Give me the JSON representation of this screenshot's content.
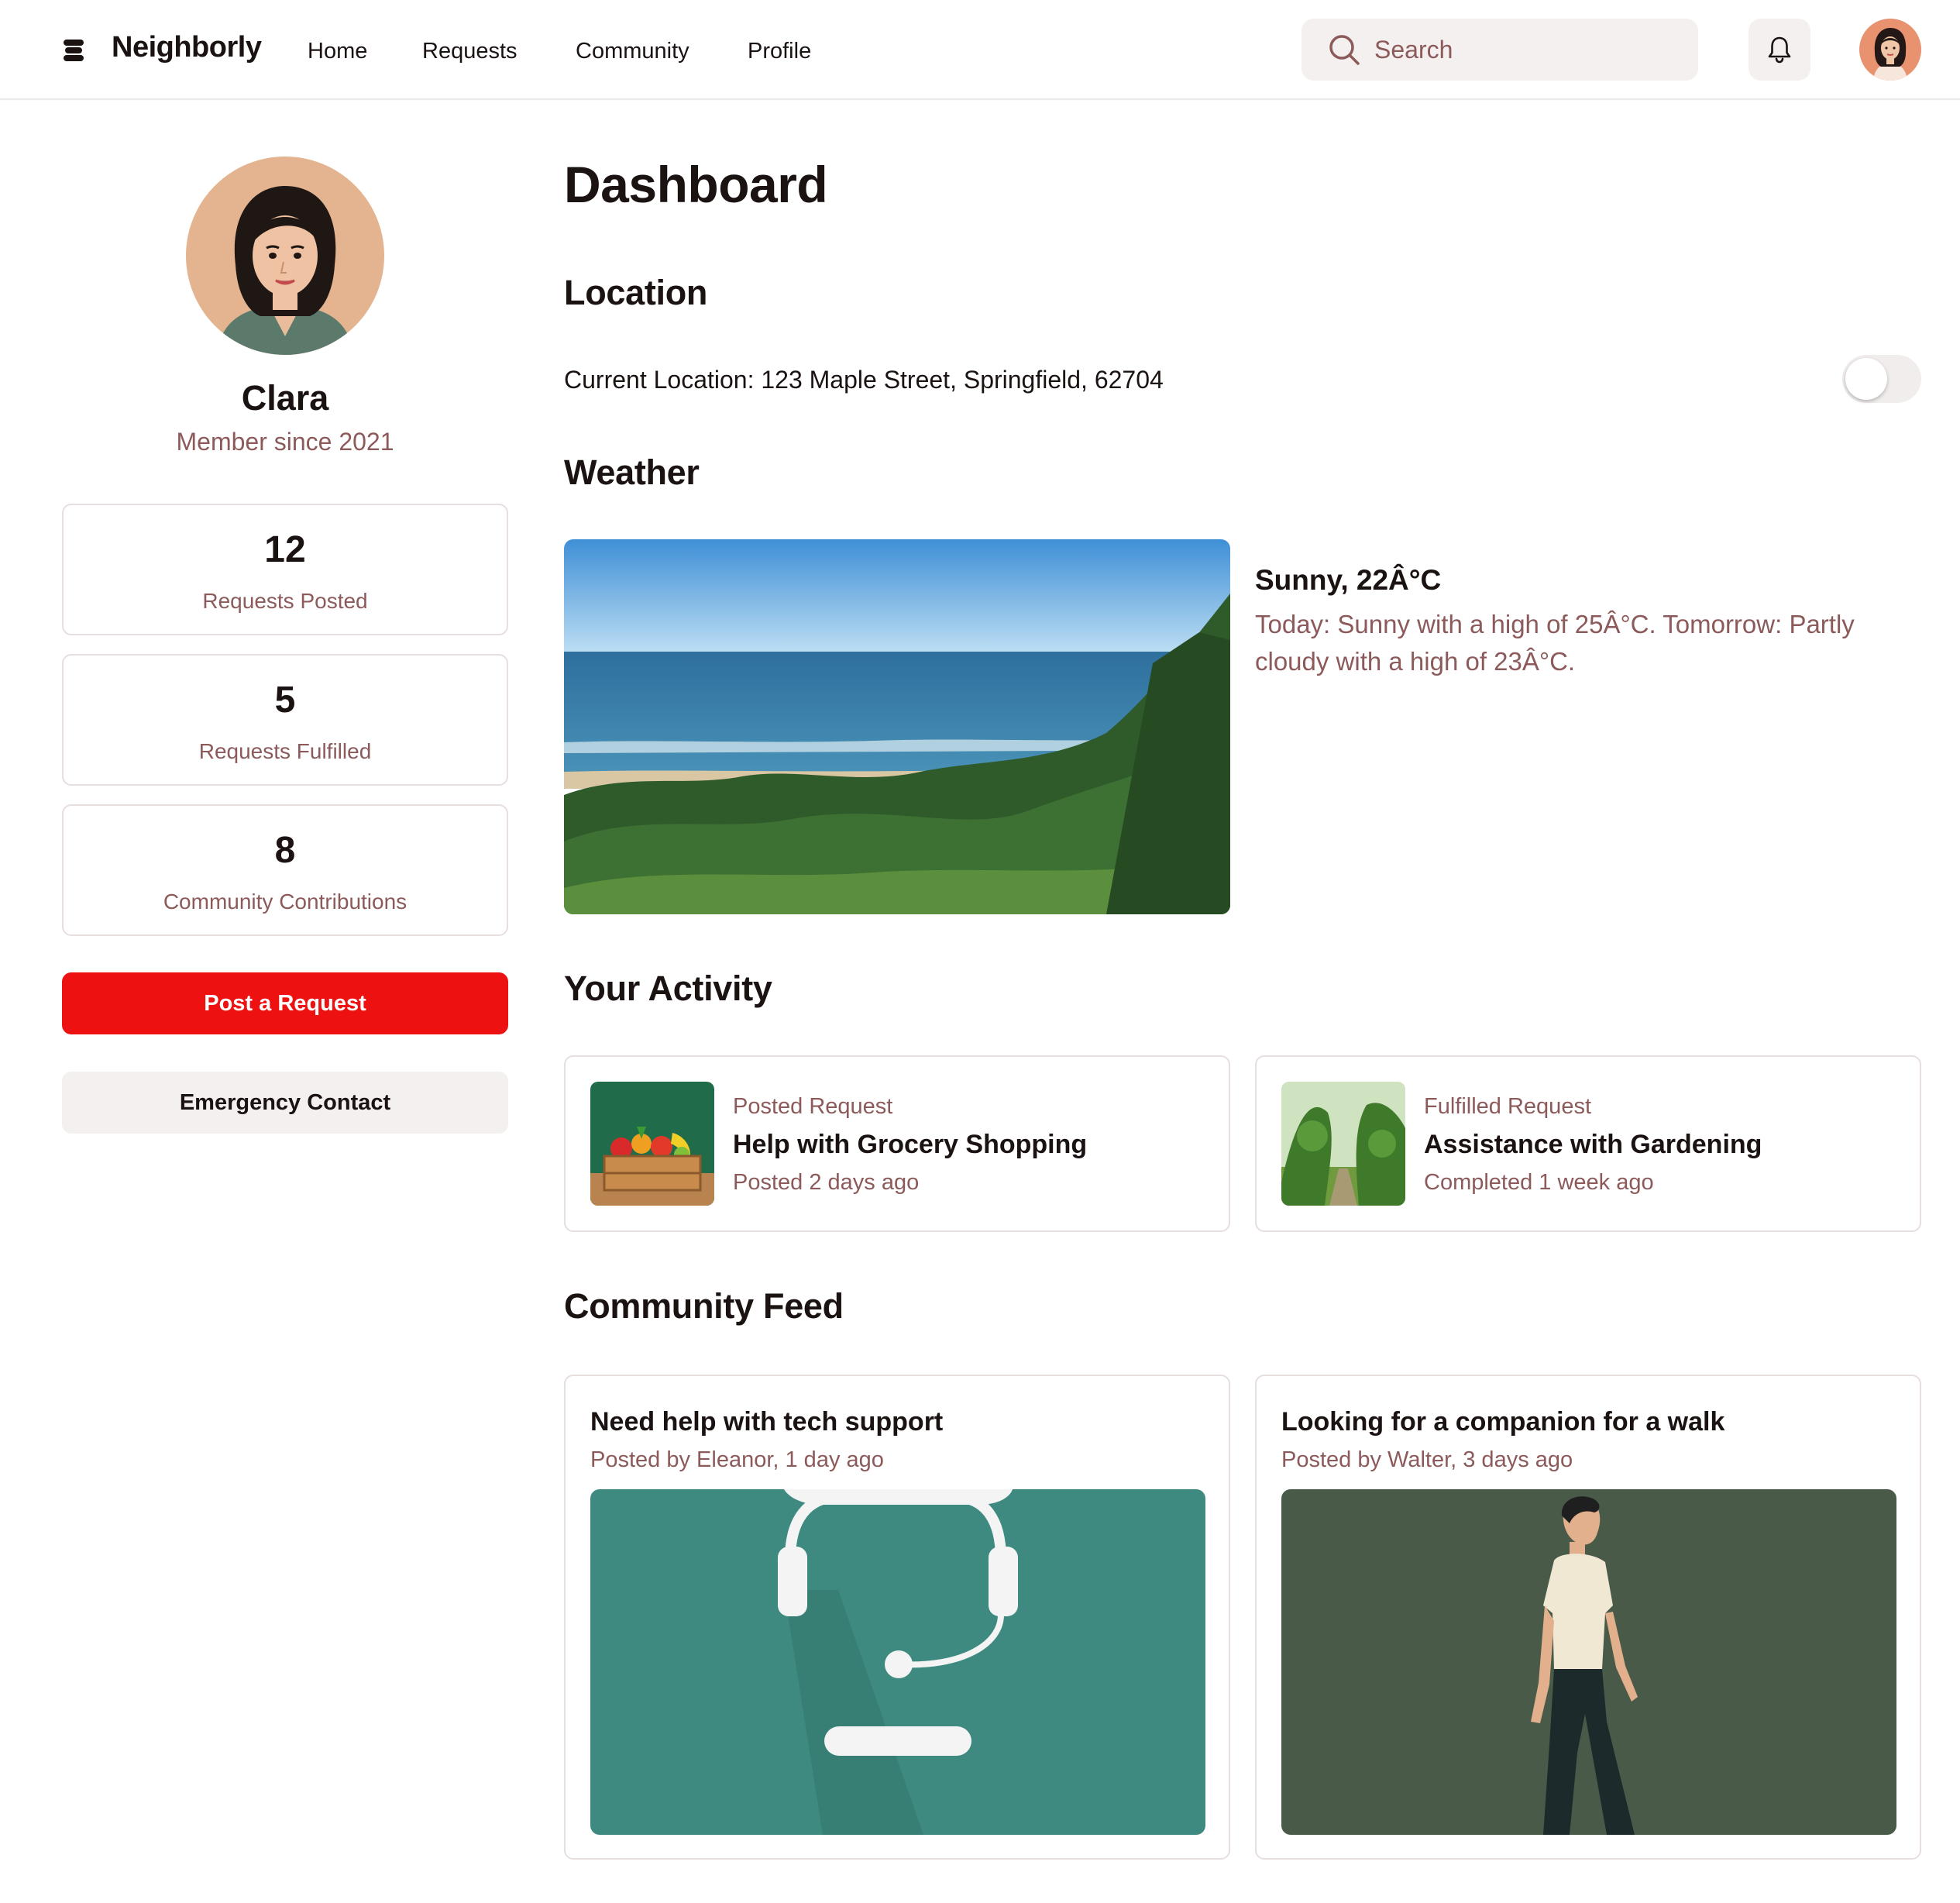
{
  "app": {
    "brand": "Neighborly",
    "logo_icon": "stacked-discs-logo-icon"
  },
  "nav": {
    "items": [
      {
        "label": "Home"
      },
      {
        "label": "Requests"
      },
      {
        "label": "Community"
      },
      {
        "label": "Profile"
      }
    ]
  },
  "search": {
    "placeholder": "Search",
    "icon": "search-icon"
  },
  "header": {
    "notifications_icon": "bell-icon",
    "avatar": "user-avatar"
  },
  "profile": {
    "name": "Clara",
    "member_since": "Member since 2021",
    "stats": [
      {
        "value": "12",
        "label": "Requests Posted"
      },
      {
        "value": "5",
        "label": "Requests Fulfilled"
      },
      {
        "value": "8",
        "label": "Community Contributions"
      }
    ],
    "primary_action": "Post a Request",
    "secondary_action": "Emergency Contact"
  },
  "dashboard": {
    "title": "Dashboard",
    "location": {
      "heading": "Location",
      "text": "Current Location: 123 Maple Street, Springfield, 62704",
      "sharing_enabled": false
    },
    "weather": {
      "heading": "Weather",
      "summary": "Sunny, 22Â°C",
      "forecast": "Today: Sunny with a high of 25Â°C. Tomorrow: Partly cloudy with a high of 23Â°C."
    },
    "activity": {
      "heading": "Your Activity",
      "items": [
        {
          "type": "Posted Request",
          "title": "Help with Grocery Shopping",
          "meta": "Posted 2 days ago"
        },
        {
          "type": "Fulfilled Request",
          "title": "Assistance with Gardening",
          "meta": "Completed 1 week ago"
        }
      ]
    },
    "feed": {
      "heading": "Community Feed",
      "items": [
        {
          "title": "Need help with tech support",
          "meta": "Posted by Eleanor, 1 day ago"
        },
        {
          "title": "Looking for a companion for a walk",
          "meta": "Posted by Walter, 3 days ago"
        }
      ]
    }
  },
  "colors": {
    "accent": "#ee1111",
    "muted_text": "#8c5a5a",
    "surface": "#f4f0ef",
    "border": "#e6dfde"
  }
}
